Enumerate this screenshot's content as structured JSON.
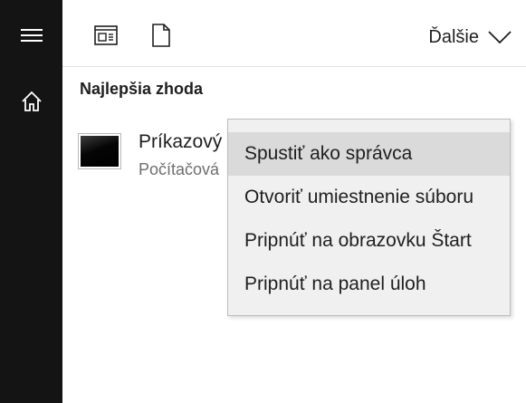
{
  "leftbar": {
    "menu_icon": "hamburger-icon",
    "home_icon": "home-icon"
  },
  "topbar": {
    "apps_icon": "apps-filter-icon",
    "documents_icon": "document-icon",
    "more_label": "Ďalšie",
    "more_icon": "chevron-down-icon"
  },
  "section_title": "Najlepšia zhoda",
  "result": {
    "name": "Príkazový",
    "kind": "Počítačová",
    "icon": "command-prompt-icon"
  },
  "context_menu": {
    "items": [
      {
        "label": "Spustiť ako správca",
        "highlighted": true
      },
      {
        "label": "Otvoriť umiestnenie súboru",
        "highlighted": false
      },
      {
        "label": "Pripnúť na obrazovku Štart",
        "highlighted": false
      },
      {
        "label": "Pripnúť na panel úloh",
        "highlighted": false
      }
    ]
  },
  "colors": {
    "leftbar_bg": "#141414",
    "menu_bg": "#f0f0f0",
    "menu_hover": "#dadada"
  }
}
